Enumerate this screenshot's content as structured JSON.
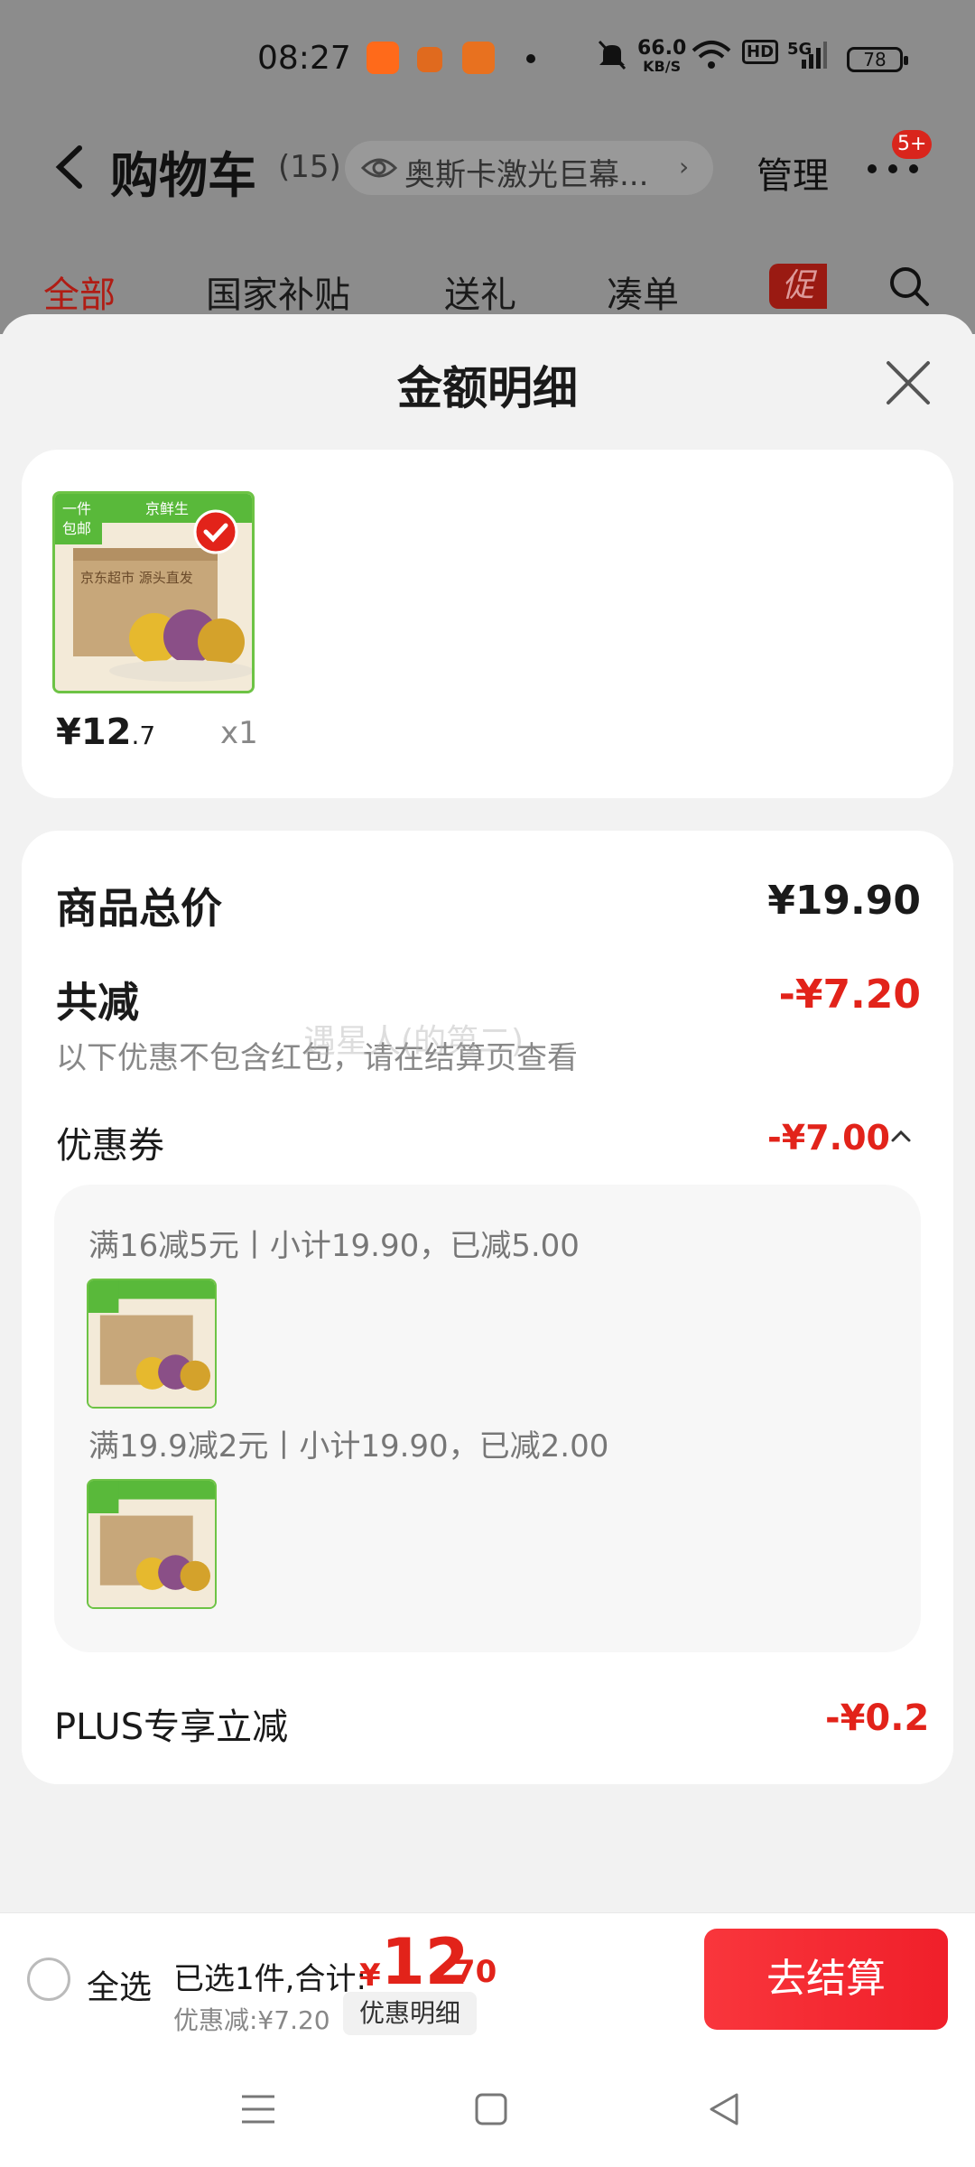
{
  "status_bar": {
    "time": "08:27",
    "net_speed": "66.0",
    "net_unit": "KB/S",
    "network": "5G",
    "battery": "78"
  },
  "header": {
    "title": "购物车",
    "count": "(15)",
    "search_text": "奥斯卡激光巨幕...",
    "manage_label": "管理",
    "badge": "5+"
  },
  "tabs": [
    {
      "label": "全部"
    },
    {
      "label": "国家补贴"
    },
    {
      "label": "送礼"
    },
    {
      "label": "凑单"
    }
  ],
  "promo_tag": "促",
  "sheet": {
    "title": "金额明细",
    "item": {
      "price_int": "¥12",
      "price_dec": ".7",
      "qty": "x1"
    },
    "total_label": "商品总价",
    "total_value": "¥19.90",
    "reduce_label": "共减",
    "reduce_value": "-¥7.20",
    "reduce_note": "以下优惠不包含红包，请在结算页查看",
    "watermark": "遇星人(的第二)",
    "coupon_label": "优惠券",
    "coupon_value": "-¥7.00",
    "coupon_rules": [
      "满16减5元丨小计19.90，已减5.00",
      "满19.9减2元丨小计19.90，已减2.00"
    ],
    "plus_label": "PLUS专享立减",
    "plus_value": "-¥0.2"
  },
  "checkout": {
    "select_all": "全选",
    "summary": "已选1件,合计:",
    "yen": "¥",
    "total_int": "12",
    "total_dec": ".70",
    "discount": "优惠减:¥7.20",
    "detail_button": "优惠明细",
    "checkout_button": "去结算"
  },
  "product_image_text": {
    "tag_line1": "一件",
    "tag_line2": "包邮",
    "brand": "京鲜生",
    "box_text": "京东超市 源头直发"
  },
  "colors": {
    "accent_red": "#e2231a",
    "tab_active": "#b01c14",
    "product_border": "#6dc345"
  },
  "icons": [
    "back-icon",
    "eye-icon",
    "more-icon",
    "search-icon",
    "close-icon",
    "check-icon",
    "chevron-up-icon",
    "menu-icon",
    "home-icon",
    "back-triangle-icon"
  ]
}
